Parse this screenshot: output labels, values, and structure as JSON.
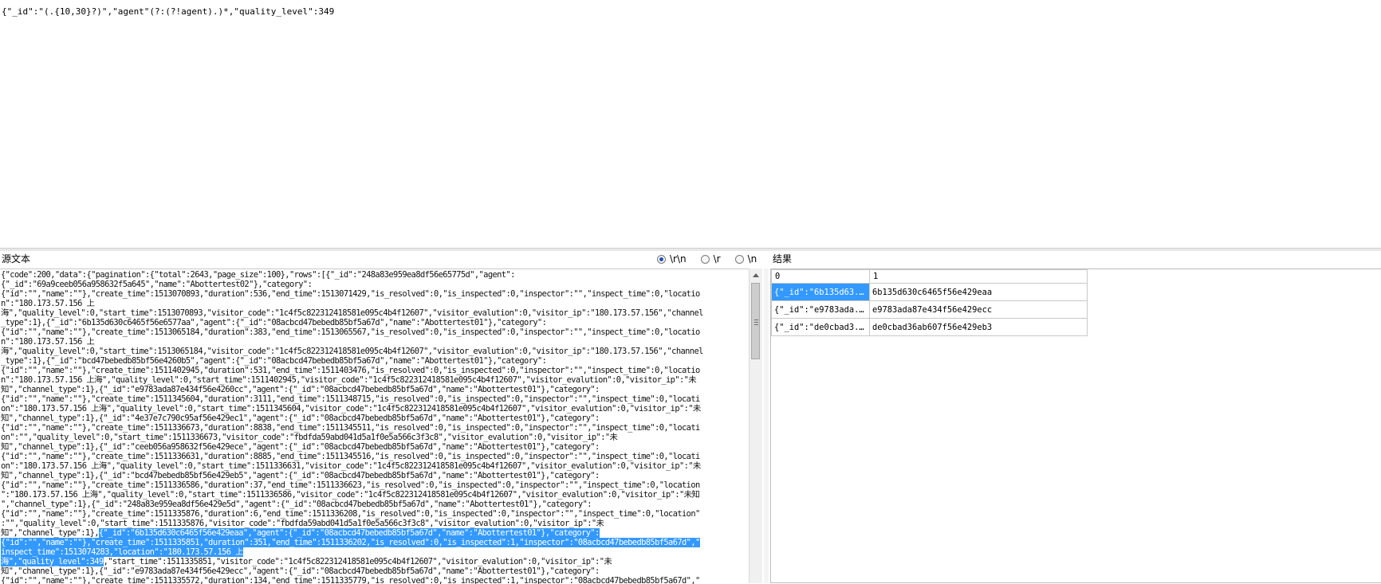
{
  "regex": {
    "text": "{\"_id\":\"(.{10,30}?)\",\"agent\"(?:(?!agent).)*,\"quality_level\":349"
  },
  "source": {
    "label": "源文本",
    "line_ending_options": [
      {
        "label": "\\r\\n",
        "selected": true
      },
      {
        "label": "\\r",
        "selected": false
      },
      {
        "label": "\\n",
        "selected": false
      }
    ],
    "lines": [
      {
        "pre": "{\"code\":200,\"data\":{\"pagination\":{\"total\":2643,\"page_size\":100},\"rows\":[{\"_id\":\"248a83e959ea8df56e65775d\",\"agent\":"
      },
      {
        "pre": "{\"_id\":\"69a9ceeb056a958632f5a645\",\"name\":\"Abottertest02\"},\"category\":"
      },
      {
        "pre": "{\"id\":\"\",\"name\":\"\"},\"create_time\":1513070893,\"duration\":536,\"end_time\":1513071429,\"is_resolved\":0,\"is_inspected\":0,\"inspector\":\"\",\"inspect_time\":0,\"locatio"
      },
      {
        "pre": "n\":\"180.173.57.156 上"
      },
      {
        "pre": "海\",\"quality_level\":0,\"start_time\":1513070893,\"visitor_code\":\"1c4f5c822312418581e095c4b4f12607\",\"visitor_evalution\":0,\"visitor_ip\":\"180.173.57.156\",\"channel"
      },
      {
        "pre": "_type\":1},{\"_id\":\"6b135d630c6465f56e6577aa\",\"agent\":{\"_id\":\"08acbcd47bebedb85bf5a67d\",\"name\":\"Abottertest01\"},\"category\":"
      },
      {
        "pre": "{\"id\":\"\",\"name\":\"\"},\"create_time\":1513065184,\"duration\":383,\"end_time\":1513065567,\"is_resolved\":0,\"is_inspected\":0,\"inspector\":\"\",\"inspect_time\":0,\"locatio"
      },
      {
        "pre": "n\":\"180.173.57.156 上"
      },
      {
        "pre": "海\",\"quality_level\":0,\"start_time\":1513065184,\"visitor_code\":\"1c4f5c822312418581e095c4b4f12607\",\"visitor_evalution\":0,\"visitor_ip\":\"180.173.57.156\",\"channel"
      },
      {
        "pre": "_type\":1},{\"_id\":\"bcd47bebedb85bf56e4260b5\",\"agent\":{\"_id\":\"08acbcd47bebedb85bf5a67d\",\"name\":\"Abottertest01\"},\"category\":"
      },
      {
        "pre": "{\"id\":\"\",\"name\":\"\"},\"create_time\":1511402945,\"duration\":531,\"end_time\":1511403476,\"is_resolved\":0,\"is_inspected\":0,\"inspector\":\"\",\"inspect_time\":0,\"locatio"
      },
      {
        "pre": "n\":\"180.173.57.156 上海\",\"quality_level\":0,\"start_time\":1511402945,\"visitor_code\":\"1c4f5c822312418581e095c4b4f12607\",\"visitor_evalution\":0,\"visitor_ip\":\"未"
      },
      {
        "pre": "知\",\"channel_type\":1},{\"_id\":\"e9783ada87e434f56e4260cc\",\"agent\":{\"_id\":\"08acbcd47bebedb85bf5a67d\",\"name\":\"Abottertest01\"},\"category\":"
      },
      {
        "pre": "{\"id\":\"\",\"name\":\"\"},\"create_time\":1511345604,\"duration\":3111,\"end_time\":1511348715,\"is_resolved\":0,\"is_inspected\":0,\"inspector\":\"\",\"inspect_time\":0,\"locati"
      },
      {
        "pre": "on\":\"180.173.57.156 上海\",\"quality_level\":0,\"start_time\":1511345604,\"visitor_code\":\"1c4f5c822312418581e095c4b4f12607\",\"visitor_evalution\":0,\"visitor_ip\":\"未"
      },
      {
        "pre": "知\",\"channel_type\":1},{\"_id\":\"4e37e7c790c95af56e429ec1\",\"agent\":{\"_id\":\"08acbcd47bebedb85bf5a67d\",\"name\":\"Abottertest01\"},\"category\":"
      },
      {
        "pre": "{\"id\":\"\",\"name\":\"\"},\"create_time\":1511336673,\"duration\":8838,\"end_time\":1511345511,\"is_resolved\":0,\"is_inspected\":0,\"inspector\":\"\",\"inspect_time\":0,\"locati"
      },
      {
        "pre": "on\":\"\",\"quality_level\":0,\"start_time\":1511336673,\"visitor_code\":\"fbdfda59abd041d5a1f0e5a566c3f3c8\",\"visitor_evalution\":0,\"visitor_ip\":\"未"
      },
      {
        "pre": "知\",\"channel_type\":1},{\"_id\":\"ceeb056a958632f56e429ece\",\"agent\":{\"_id\":\"08acbcd47bebedb85bf5a67d\",\"name\":\"Abottertest01\"},\"category\":"
      },
      {
        "pre": "{\"id\":\"\",\"name\":\"\"},\"create_time\":1511336631,\"duration\":8885,\"end_time\":1511345516,\"is_resolved\":0,\"is_inspected\":0,\"inspector\":\"\",\"inspect_time\":0,\"locati"
      },
      {
        "pre": "on\":\"180.173.57.156 上海\",\"quality_level\":0,\"start_time\":1511336631,\"visitor_code\":\"1c4f5c822312418581e095c4b4f12607\",\"visitor_evalution\":0,\"visitor_ip\":\"未"
      },
      {
        "pre": "知\",\"channel_type\":1},{\"_id\":\"bcd47bebedb85bf56e429eb5\",\"agent\":{\"_id\":\"08acbcd47bebedb85bf5a67d\",\"name\":\"Abottertest01\"},\"category\":"
      },
      {
        "pre": "{\"id\":\"\",\"name\":\"\"},\"create_time\":1511336586,\"duration\":37,\"end_time\":1511336623,\"is_resolved\":0,\"is_inspected\":0,\"inspector\":\"\",\"inspect_time\":0,\"location"
      },
      {
        "pre": "\":\"180.173.57.156 上海\",\"quality_level\":0,\"start_time\":1511336586,\"visitor_code\":\"1c4f5c822312418581e095c4b4f12607\",\"visitor_evalution\":0,\"visitor_ip\":\"未知"
      },
      {
        "pre": "\",\"channel_type\":1},{\"_id\":\"248a83e959ea8df56e429e5d\",\"agent\":{\"_id\":\"08acbcd47bebedb85bf5a67d\",\"name\":\"Abottertest01\"},\"category\":"
      },
      {
        "pre": "{\"id\":\"\",\"name\":\"\"},\"create_time\":1511335876,\"duration\":6,\"end_time\":1511336208,\"is_resolved\":0,\"is_inspected\":0,\"inspector\":\"\",\"inspect_time\":0,\"location\""
      },
      {
        "pre": ":\"\",\"quality_level\":0,\"start_time\":1511335876,\"visitor_code\":\"fbdfda59abd041d5a1f0e5a566c3f3c8\",\"visitor_evalution\":0,\"visitor_ip\":\"未"
      },
      {
        "pre": "知\",\"channel_type\":1},",
        "sel": "{\"_id\":\"6b135d630c6465f56e429eaa\",\"agent\":{\"_id\":\"08acbcd47bebedb85bf5a67d\",\"name\":\"Abottertest01\"},\"category\":"
      },
      {
        "pre": "",
        "sel": "{\"id\":\"\",\"name\":\"\"},\"create_time\":1511335851,\"duration\":351,\"end_time\":1511336202,\"is_resolved\":0,\"is_inspected\":1,\"inspector\":\"08acbcd47bebedb85bf5a67d\",\""
      },
      {
        "pre": "",
        "sel": "inspect_time\":1513074283,\"location\":\"180.173.57.156 上"
      },
      {
        "pre": "",
        "sel": "海\",\"quality_level\":349",
        "post": ",\"start_time\":1511335851,\"visitor_code\":\"1c4f5c822312418581e095c4b4f12607\",\"visitor_evalution\":0,\"visitor_ip\":\"未"
      },
      {
        "pre": "知\",\"channel_type\":1},{\"_id\":\"e9783ada87e434f56e429ecc\",\"agent\":{\"_id\":\"08acbcd47bebedb85bf5a67d\",\"name\":\"Abottertest01\"},\"category\":"
      },
      {
        "pre": "{\"id\":\"\",\"name\":\"\"},\"create_time\":1511335572,\"duration\":134,\"end_time\":1511335779,\"is_resolved\":0,\"is_inspected\":1,\"inspector\":\"08acbcd47bebedb85bf5a67d\",\""
      }
    ]
  },
  "results": {
    "label": "结果",
    "columns": [
      "0",
      "1"
    ],
    "rows": [
      {
        "c0": "{\"_id\":\"6b135d63...",
        "c1": "6b135d630c6465f56e429eaa",
        "selected": true
      },
      {
        "c0": "{\"_id\":\"e9783ada...",
        "c1": "e9783ada87e434f56e429ecc",
        "selected": false
      },
      {
        "c0": "{\"_id\":\"de0cbad3...",
        "c1": "de0cbad36ab607f56e429eb3",
        "selected": false
      }
    ]
  }
}
